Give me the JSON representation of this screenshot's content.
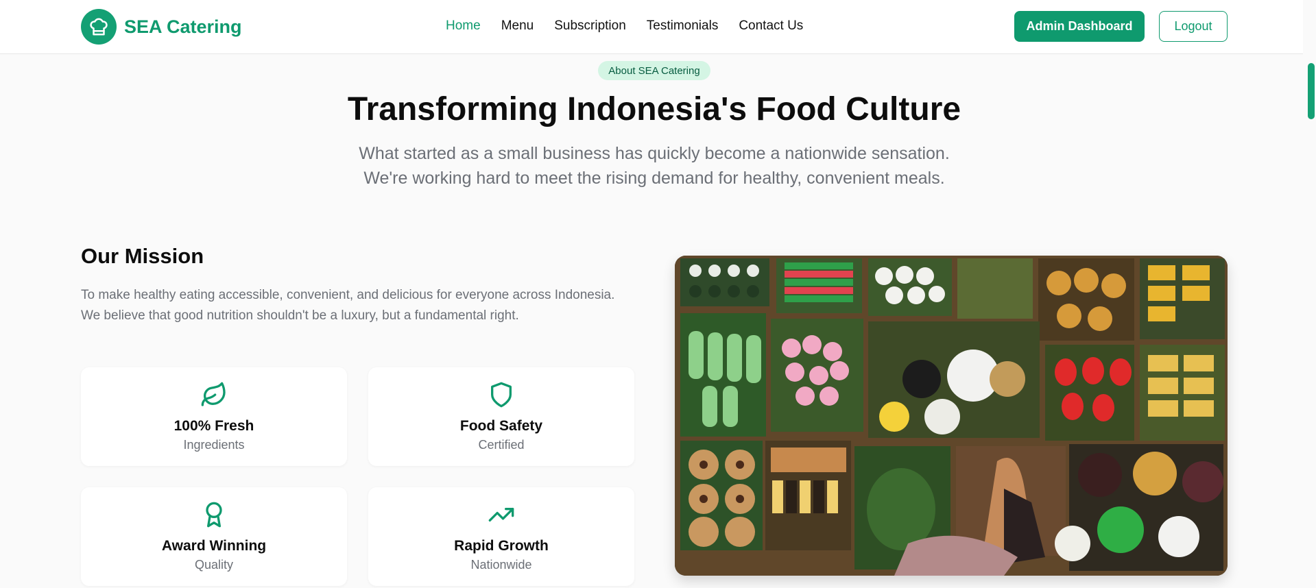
{
  "brand": {
    "name": "SEA Catering",
    "color": "#0f9a6e"
  },
  "nav": [
    {
      "label": "Home",
      "active": true
    },
    {
      "label": "Menu",
      "active": false
    },
    {
      "label": "Subscription",
      "active": false
    },
    {
      "label": "Testimonials",
      "active": false
    },
    {
      "label": "Contact Us",
      "active": false
    }
  ],
  "actions": {
    "admin_label": "Admin Dashboard",
    "logout_label": "Logout"
  },
  "hero": {
    "badge": "About SEA Catering",
    "title": "Transforming Indonesia's Food Culture",
    "subtitle_line1": "What started as a small business has quickly become a nationwide sensation.",
    "subtitle_line2": "We're working hard to meet the rising demand for healthy, convenient meals."
  },
  "mission": {
    "title": "Our Mission",
    "text": "To make healthy eating accessible, convenient, and delicious for everyone across Indonesia. We believe that good nutrition shouldn't be a luxury, but a fundamental right.",
    "cards": [
      {
        "icon": "leaf-icon",
        "title": "100% Fresh",
        "subtitle": "Ingredients"
      },
      {
        "icon": "shield-icon",
        "title": "Food Safety",
        "subtitle": "Certified"
      },
      {
        "icon": "award-icon",
        "title": "Award Winning",
        "subtitle": "Quality"
      },
      {
        "icon": "trending-up-icon",
        "title": "Rapid Growth",
        "subtitle": "Nationwide"
      }
    ]
  },
  "theme": {
    "accent": "#0f9a6e",
    "badge_bg": "#d4f5e4",
    "muted_text": "#6b6f76"
  }
}
